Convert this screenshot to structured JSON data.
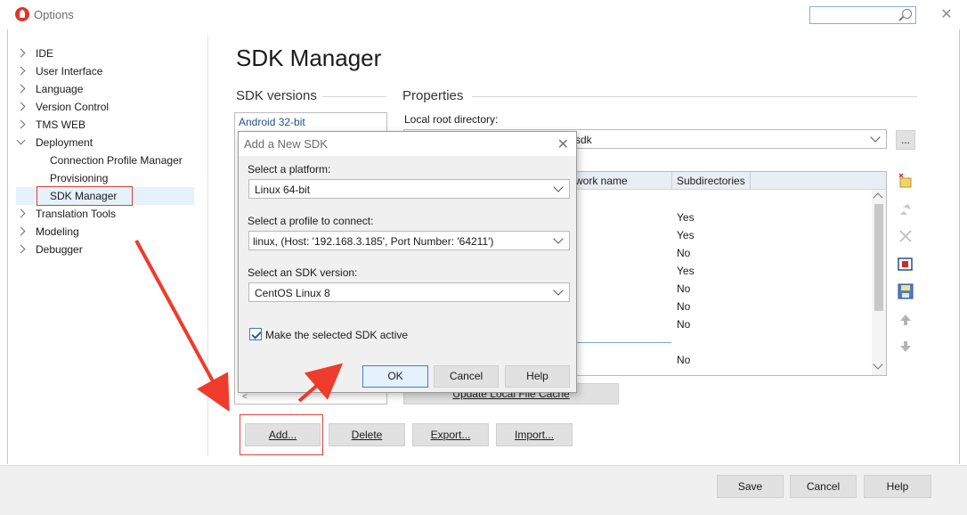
{
  "window": {
    "title": "Options"
  },
  "tree": {
    "items": [
      {
        "label": "IDE",
        "expanded": false
      },
      {
        "label": "User Interface",
        "expanded": false
      },
      {
        "label": "Language",
        "expanded": false
      },
      {
        "label": "Version Control",
        "expanded": false
      },
      {
        "label": "TMS WEB",
        "expanded": false
      },
      {
        "label": "Deployment",
        "expanded": true
      },
      {
        "label": "Connection Profile Manager",
        "child": true
      },
      {
        "label": "Provisioning",
        "child": true
      },
      {
        "label": "SDK Manager",
        "child": true,
        "selected": true
      },
      {
        "label": "Translation Tools",
        "expanded": false
      },
      {
        "label": "Modeling",
        "expanded": false
      },
      {
        "label": "Debugger",
        "expanded": false
      }
    ]
  },
  "page": {
    "title": "SDK Manager",
    "sdk_versions_header": "SDK versions",
    "properties_header": "Properties",
    "sdk_list_first": "Android 32-bit",
    "local_root_label": "Local root directory:",
    "local_root_value": "sdk",
    "browse_label": "...",
    "grid": {
      "col_framework": "work name",
      "col_subdirs": "Subdirectories",
      "subdirs": [
        "Yes",
        "Yes",
        "No",
        "Yes",
        "No",
        "No",
        "No",
        "No",
        "No"
      ]
    },
    "update_cache_label": "Update Local File Cache",
    "buttons": {
      "add": "Add...",
      "delete": "Delete",
      "export": "Export...",
      "import": "Import..."
    }
  },
  "footer": {
    "save": "Save",
    "cancel": "Cancel",
    "help": "Help"
  },
  "dialog": {
    "title": "Add a New SDK",
    "platform_label": "Select a platform:",
    "platform_value": "Linux 64-bit",
    "profile_label": "Select a profile to connect:",
    "profile_value": "linux, (Host: '192.168.3.185', Port Number: '64211')",
    "version_label": "Select an SDK version:",
    "version_value": "CentOS Linux 8",
    "make_active_label": "Make the selected SDK active",
    "make_active_checked": true,
    "ok": "OK",
    "cancel": "Cancel",
    "help": "Help"
  },
  "colors": {
    "annotation": "#d8423a",
    "accent": "#3c7fd0"
  }
}
